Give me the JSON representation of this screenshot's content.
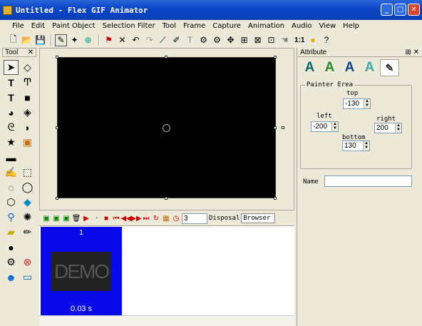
{
  "window": {
    "title": "Untitled - Flex GIF Animator",
    "min": "_",
    "max": "□",
    "close": "✕"
  },
  "menu": [
    "File",
    "Edit",
    "Paint Object",
    "Selection Filter",
    "Tool",
    "Frame",
    "Capture",
    "Animation",
    "Audio",
    "View",
    "Help"
  ],
  "toolbar": {
    "zoom_label": "1:1"
  },
  "tools_panel": {
    "title": "Tool",
    "close": "✕"
  },
  "timeline": {
    "frame_value": "3",
    "disposal_label": "Disposal",
    "browser_label": "Browser de"
  },
  "frames": [
    {
      "number": "1",
      "watermark": "DEMO",
      "delay": "0.03 s"
    }
  ],
  "attribute": {
    "title": "Attribute",
    "pin": "⊞ ✕",
    "group_title": "Painter Erea",
    "top_label": "top",
    "top_value": "-130",
    "left_label": "left",
    "left_value": "-200",
    "right_label": "right",
    "right_value": "200",
    "bottom_label": "bottom",
    "bottom_value": "130",
    "name_label": "Name",
    "name_value": ""
  },
  "colors": {
    "title_bar": "#0a46c8",
    "frame_bg": "#0a0ae8",
    "canvas": "#000000"
  }
}
